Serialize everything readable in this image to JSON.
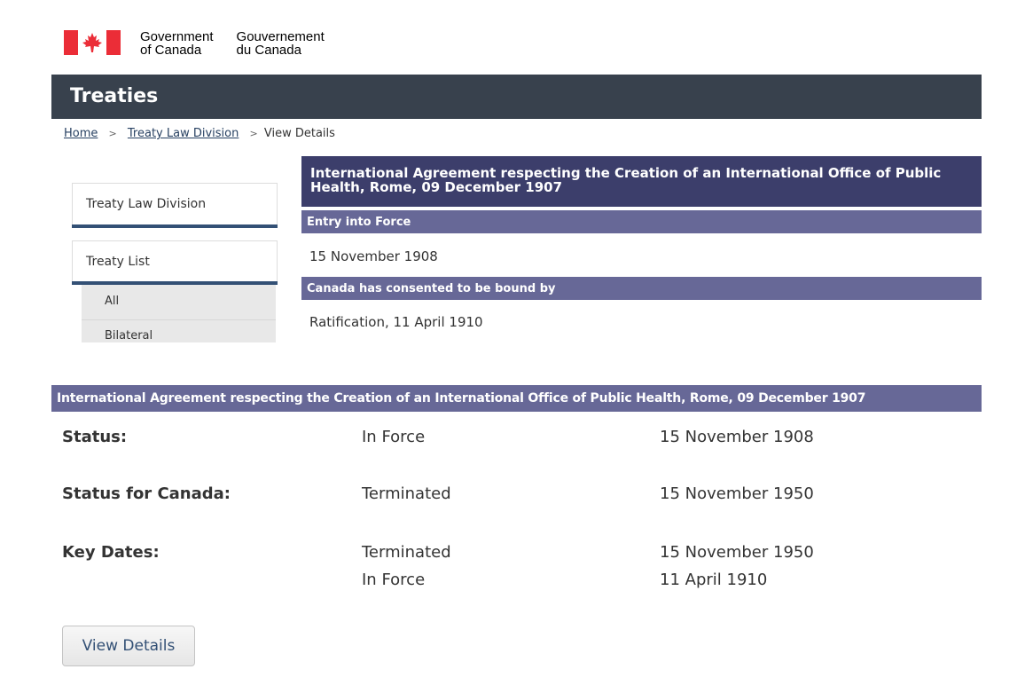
{
  "header": {
    "gov_en_line1": "Government",
    "gov_en_line2": "of Canada",
    "gov_fr_line1": "Gouvernement",
    "gov_fr_line2": "du Canada",
    "site_title": "Treaties"
  },
  "breadcrumb": {
    "home": "Home",
    "treaty_law": "Treaty Law Division",
    "current": "View Details",
    "sep": ">"
  },
  "sidebar": {
    "section1": "Treaty Law Division",
    "section2": "Treaty List",
    "items": [
      "All",
      "Bilateral"
    ]
  },
  "panel": {
    "title": "International Agreement respecting the Creation of an International Office of Public Health, Rome, 09 December 1907",
    "entry_label": "Entry into Force",
    "entry_value": "15 November 1908",
    "consent_label": "Canada has consented to be bound by",
    "consent_value": "Ratification, 11 April 1910"
  },
  "card": {
    "title": "International Agreement respecting the Creation of an International Office of Public Health, Rome, 09 December 1907",
    "status_label": "Status:",
    "status_value": "In Force",
    "status_date": "15 November 1908",
    "canada_label": "Status for Canada:",
    "canada_value": "Terminated",
    "canada_date": "15 November 1950",
    "keydates_label": "Key Dates:",
    "keydates": [
      {
        "event": "Terminated",
        "date": "15 November 1950"
      },
      {
        "event": "In Force",
        "date": "11 April 1910"
      }
    ],
    "button_label": "View Details"
  },
  "colors": {
    "flag_red": "#eb2d37",
    "title_band": "#38414d",
    "panel_title_bg": "#3c3e6b",
    "panel_head_bg": "#676897",
    "nav_rule": "#335075"
  },
  "icons": {
    "flag": "canada-flag-icon",
    "breadcrumb_sep": "chevron-right-icon"
  }
}
